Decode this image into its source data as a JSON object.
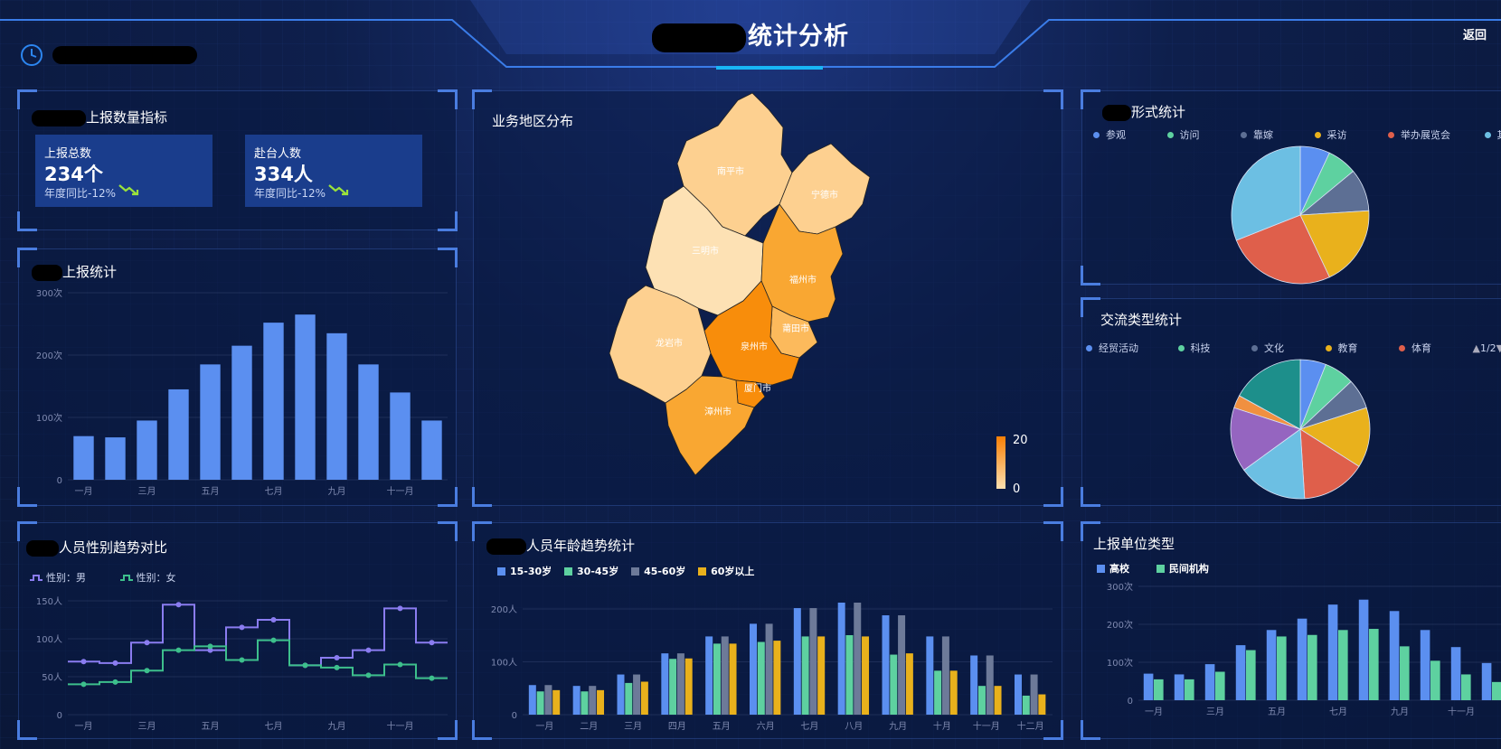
{
  "header": {
    "title": "统计分析",
    "back_label": "返回"
  },
  "kpi_panel": {
    "title": "上报数量指标",
    "cards": [
      {
        "label": "上报总数",
        "value": "234个",
        "compare": "年度同比-12%"
      },
      {
        "label": "赴台人数",
        "value": "334人",
        "compare": "年度同比-12%"
      }
    ]
  },
  "report_stats": {
    "title": "上报统计",
    "chart_data": {
      "type": "bar",
      "categories": [
        "一月",
        "二月",
        "三月",
        "四月",
        "五月",
        "六月",
        "七月",
        "八月",
        "九月",
        "十月",
        "十一月",
        "十二月"
      ],
      "x_tick_labels": [
        "一月",
        "三月",
        "五月",
        "七月",
        "九月",
        "十一月"
      ],
      "values": [
        70,
        68,
        95,
        145,
        185,
        215,
        252,
        265,
        235,
        185,
        140,
        95
      ],
      "ylim": [
        0,
        300
      ],
      "y_ticks": [
        "0",
        "100次",
        "200次",
        "300次"
      ],
      "colors": [
        "#5b8ff0"
      ]
    }
  },
  "map_panel": {
    "title": "业务地区分布",
    "cities": [
      "南平市",
      "宁德市",
      "三明市",
      "福州市",
      "莆田市",
      "龙岩市",
      "泉州市",
      "厦门市",
      "漳州市"
    ],
    "visual_map": {
      "max": "20",
      "min": "0"
    }
  },
  "form_stats": {
    "title": "形式统计",
    "legend": [
      "参观",
      "访问",
      "靠嫁",
      "采访",
      "举办展览会",
      "其他"
    ],
    "chart_data": {
      "type": "pie",
      "labels": [
        "参观",
        "访问",
        "靠嫁",
        "采访",
        "举办展览会",
        "其他"
      ],
      "values": [
        7,
        7,
        10,
        19,
        26,
        31
      ],
      "colors": [
        "#5b8ff0",
        "#5ed1a0",
        "#5d6f94",
        "#e9b11c",
        "#df5f4b",
        "#6cbfe3"
      ]
    }
  },
  "exchange_stats": {
    "title": "交流类型统计",
    "legend": [
      "经贸活动",
      "科技",
      "文化",
      "教育",
      "体育"
    ],
    "pager": "1/2",
    "chart_data": {
      "type": "pie",
      "values": [
        6,
        7,
        7,
        14,
        15,
        16,
        15,
        3,
        17
      ],
      "colors": [
        "#5b8ff0",
        "#5ed1a0",
        "#5d6f94",
        "#e9b11c",
        "#df5f4b",
        "#6cbfe3",
        "#9565c0",
        "#f09040",
        "#1d8f8b"
      ]
    }
  },
  "gender_trend": {
    "title": "人员性别趋势对比",
    "chart_data": {
      "type": "line",
      "x": [
        "一月",
        "二月",
        "三月",
        "四月",
        "五月",
        "六月",
        "七月",
        "八月",
        "九月",
        "十月",
        "十一月",
        "十二月"
      ],
      "x_tick_labels": [
        "一月",
        "三月",
        "五月",
        "七月",
        "九月",
        "十一月"
      ],
      "series": [
        {
          "name": "性别：男",
          "values": [
            70,
            68,
            95,
            145,
            85,
            115,
            125,
            65,
            75,
            85,
            140,
            95
          ],
          "color": "#8a7cf0"
        },
        {
          "name": "性别：女",
          "values": [
            40,
            43,
            58,
            85,
            90,
            72,
            98,
            65,
            62,
            52,
            66,
            48
          ],
          "color": "#3dbf8c"
        }
      ],
      "ylim": [
        0,
        150
      ],
      "y_ticks": [
        "0",
        "50人",
        "100人",
        "150人"
      ]
    }
  },
  "age_trend": {
    "title": "人员年龄趋势统计",
    "chart_data": {
      "type": "bar",
      "categories": [
        "一月",
        "二月",
        "三月",
        "四月",
        "五月",
        "六月",
        "七月",
        "八月",
        "九月",
        "十月",
        "十一月",
        "十二月"
      ],
      "series": [
        {
          "name": "15-30岁",
          "values": [
            70,
            68,
            95,
            145,
            185,
            215,
            252,
            265,
            235,
            185,
            140,
            95
          ],
          "color": "#5b8ff0"
        },
        {
          "name": "30-45岁",
          "values": [
            55,
            55,
            75,
            132,
            168,
            172,
            185,
            188,
            142,
            104,
            68,
            45
          ],
          "color": "#5ed1a0"
        },
        {
          "name": "45-60岁",
          "values": [
            70,
            68,
            95,
            145,
            185,
            215,
            252,
            265,
            235,
            185,
            140,
            95
          ],
          "color": "#6d7a99"
        },
        {
          "name": "60岁以上",
          "values": [
            58,
            58,
            78,
            133,
            168,
            175,
            185,
            185,
            145,
            104,
            68,
            48
          ],
          "color": "#e9b11c"
        }
      ],
      "ylim": [
        0,
        250
      ],
      "y_ticks": [
        "0",
        "100人",
        "200人"
      ]
    }
  },
  "unit_type": {
    "title": "上报单位类型",
    "chart_data": {
      "type": "bar",
      "categories": [
        "一月",
        "二月",
        "三月",
        "四月",
        "五月",
        "六月",
        "七月",
        "八月",
        "九月",
        "十月",
        "十一月",
        "十二月"
      ],
      "x_tick_labels": [
        "一月",
        "三月",
        "五月",
        "七月",
        "九月",
        "十一月"
      ],
      "series": [
        {
          "name": "高校",
          "values": [
            70,
            68,
            95,
            145,
            185,
            215,
            252,
            265,
            235,
            185,
            140,
            98
          ],
          "color": "#5b8ff0"
        },
        {
          "name": "民间机构",
          "values": [
            55,
            55,
            75,
            132,
            168,
            172,
            185,
            188,
            142,
            104,
            68,
            48
          ],
          "color": "#5ed1a0"
        }
      ],
      "ylim": [
        0,
        300
      ],
      "y_ticks": [
        "0",
        "100次",
        "200次",
        "300次"
      ]
    }
  }
}
